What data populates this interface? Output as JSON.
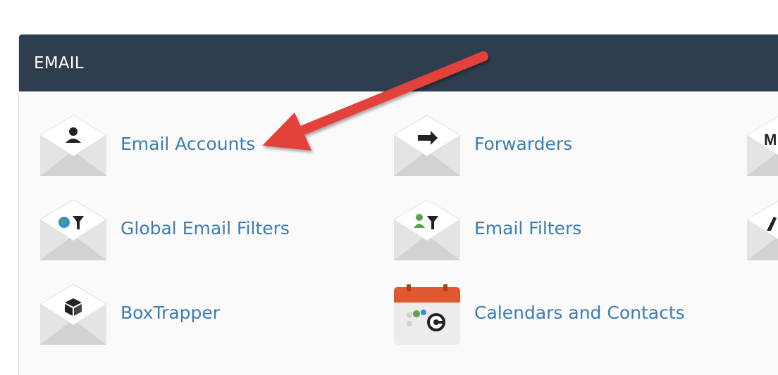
{
  "section": {
    "title": "EMAIL"
  },
  "items": {
    "email_accounts": {
      "label": "Email Accounts"
    },
    "forwarders": {
      "label": "Forwarders"
    },
    "global_email_filters": {
      "label": "Global Email Filters"
    },
    "email_filters": {
      "label": "Email Filters"
    },
    "boxtrapper": {
      "label": "BoxTrapper"
    },
    "calendars_contacts": {
      "label": "Calendars and Contacts"
    },
    "partial_right_1": {
      "icon_glyph": "M"
    }
  },
  "icons": {
    "email_accounts": "user-envelope-icon",
    "forwarders": "arrow-right-envelope-icon",
    "global_email_filters": "globe-filter-envelope-icon",
    "email_filters": "user-filter-envelope-icon",
    "boxtrapper": "box-envelope-icon",
    "calendars_contacts": "calendar-icon"
  },
  "colors": {
    "header_bg": "#2f3e4e",
    "link": "#3e7cb1",
    "annotation_arrow": "#e3433b",
    "calendar_top": "#e0582f",
    "globe": "#2f8fd3",
    "person_green": "#58a64a"
  }
}
